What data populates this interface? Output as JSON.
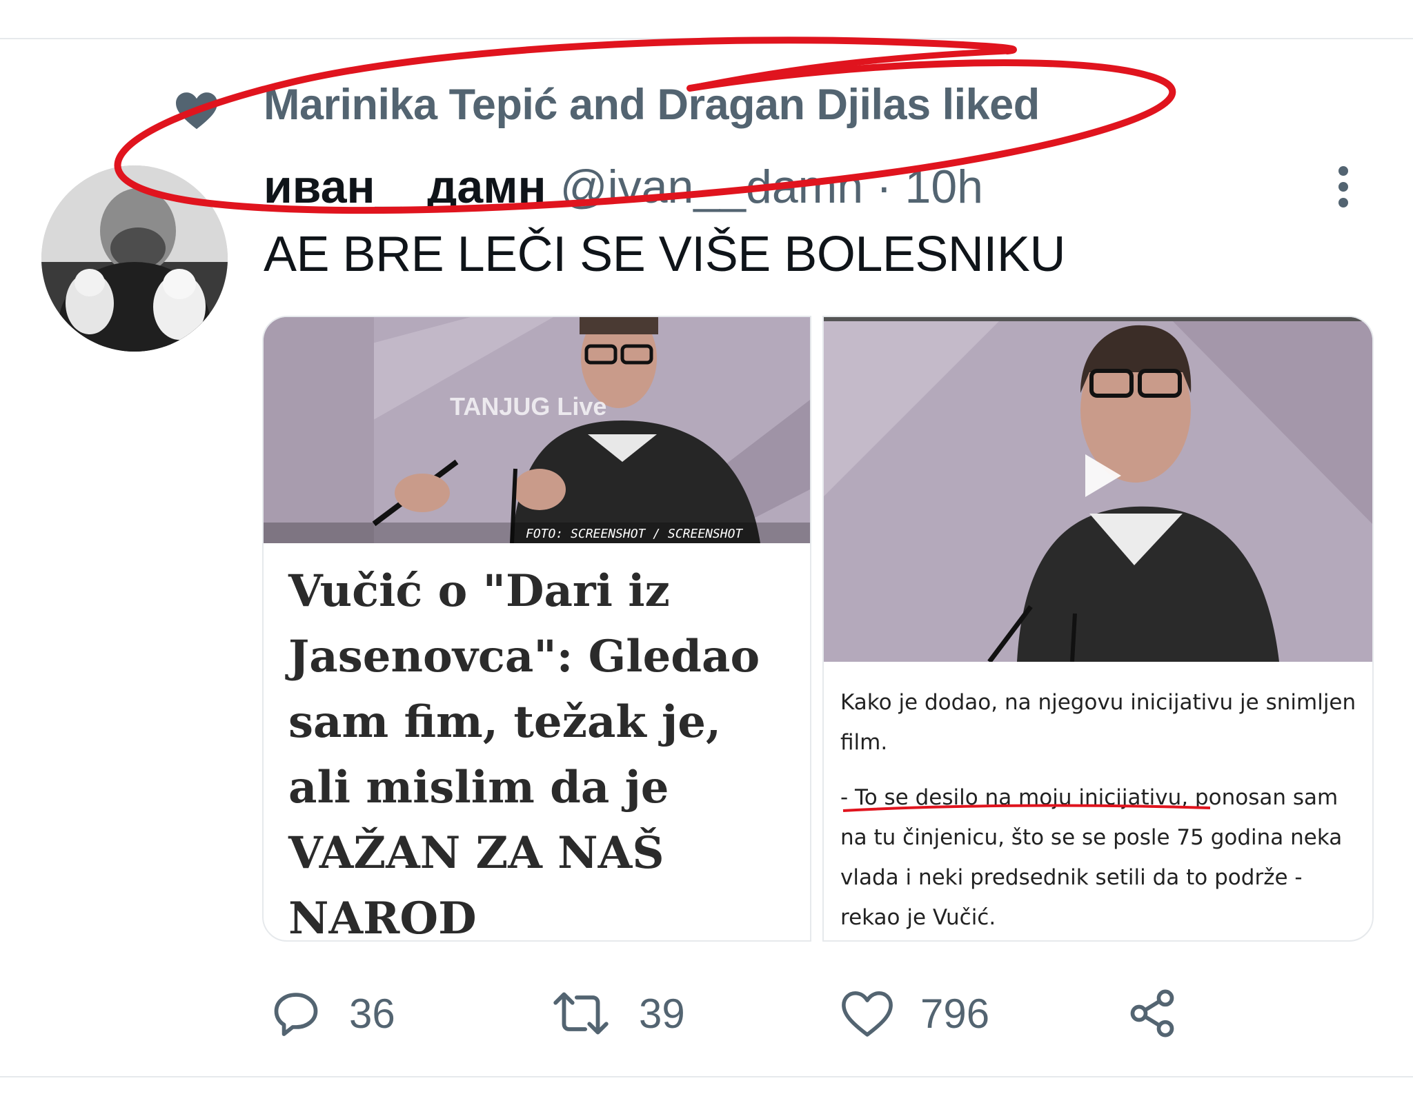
{
  "social_context": {
    "text": "Marinika Tepić and Dragan Djilas liked",
    "icon": "heart-icon"
  },
  "tweet": {
    "display_name": "иван__дамн",
    "handle_time": "@ivan__damn · 10h",
    "text": "AE BRE LEČI SE VIŠE BOLESNIKU",
    "more_icon": "more-vertical-icon"
  },
  "card_left": {
    "watermark": "TANJUG Live",
    "photo_credit": "FOTO: SCREENSHOT / SCREENSHOT",
    "headline": "Vučić o \"Dari iz Jasenovca\": Gledao sam fim, težak je, ali mislim da je VAŽAN ZA NAŠ NAROD"
  },
  "card_right": {
    "play_icon": "play-icon",
    "paragraph1": "Kako je dodao, na njegovu inicijativu je snimljen film.",
    "paragraph2": "- To se desilo na moju inicijativu, ponosan sam na tu činjenicu, što se se posle 75 godina neka vlada i neki predsednik setili da to podrže - rekao je Vučić."
  },
  "actions": {
    "reply_count": "36",
    "retweet_count": "39",
    "like_count": "796",
    "reply_icon": "reply-icon",
    "retweet_icon": "retweet-icon",
    "like_icon": "heart-icon",
    "share_icon": "share-icon"
  },
  "colors": {
    "secondary_text": "#536471",
    "annotation_red": "#e0141e",
    "photo_background": "#b4a9bb"
  }
}
